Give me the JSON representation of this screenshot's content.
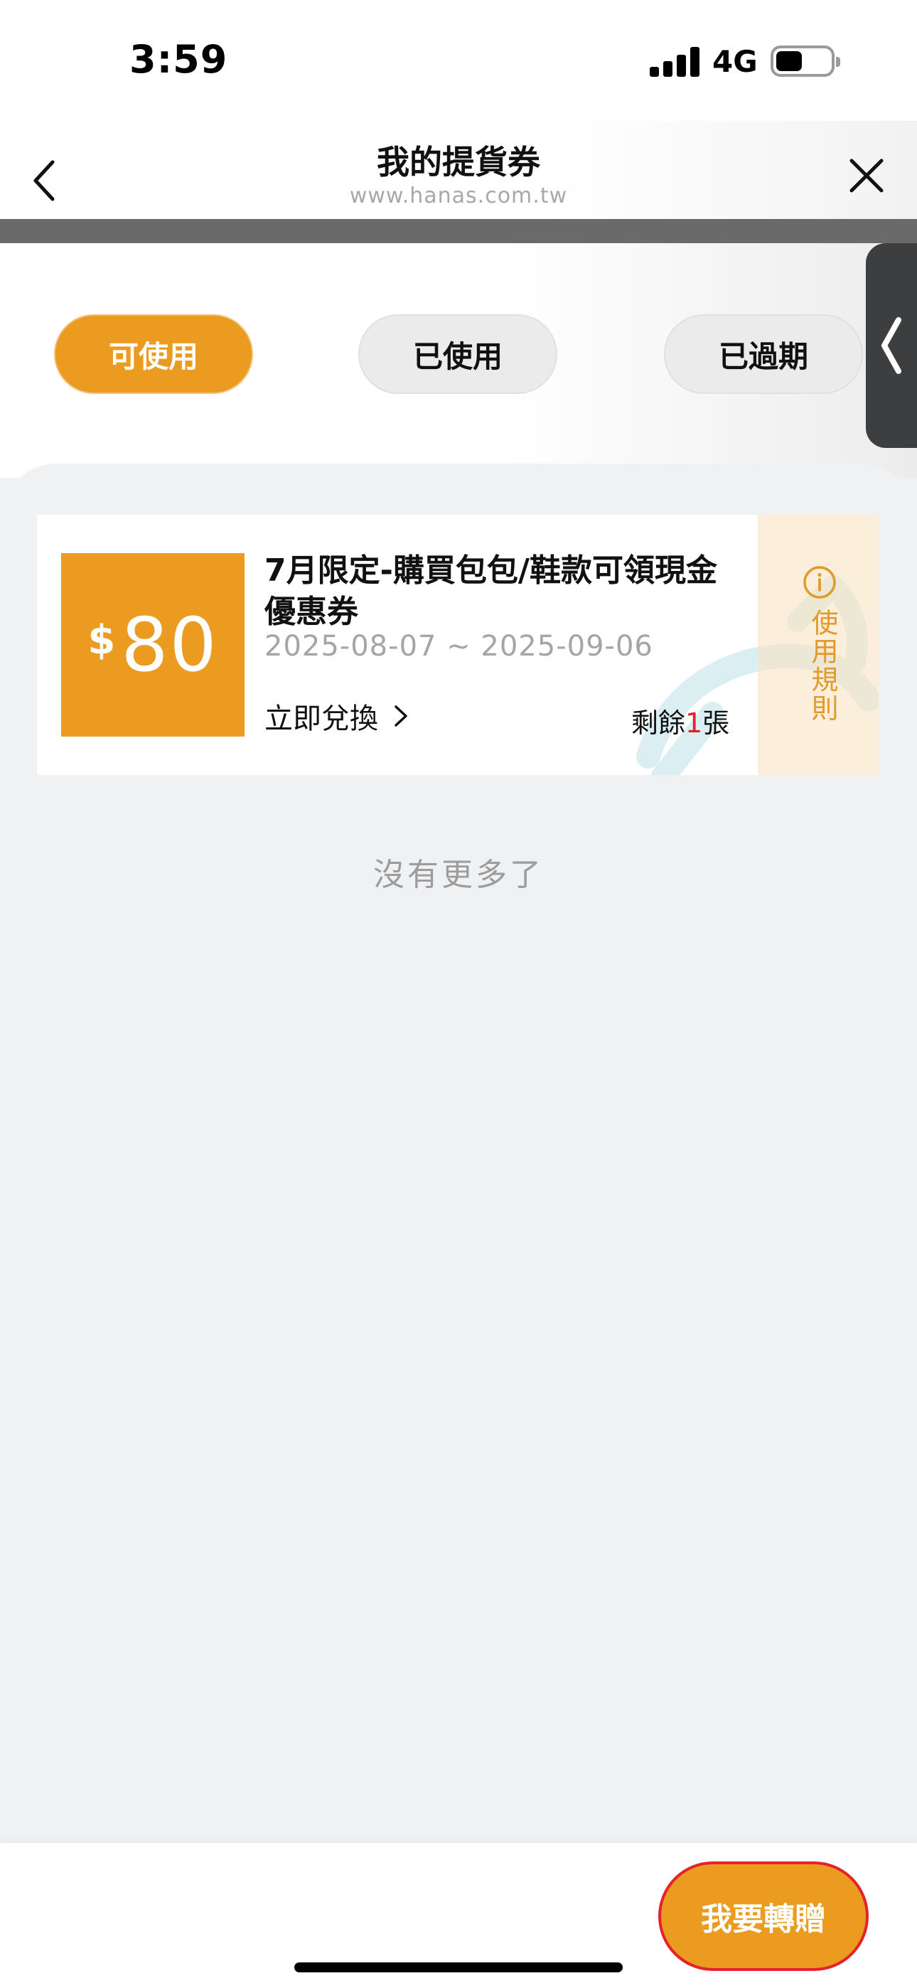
{
  "status_bar": {
    "time": "3:59",
    "network": "4G",
    "signal_level": 4,
    "battery_level": 0.45
  },
  "header": {
    "title": "我的提貨券",
    "subtitle": "www.hanas.com.tw",
    "back_icon": "chevron-left-icon",
    "close_icon": "close-icon"
  },
  "tabs": [
    {
      "label": "可使用",
      "active": true
    },
    {
      "label": "已使用",
      "active": false
    },
    {
      "label": "已過期",
      "active": false
    }
  ],
  "coupon": {
    "currency": "$",
    "amount": "80",
    "title": "7月限定-購買包包/鞋款可領現金優惠券",
    "dates": "2025-08-07 ~ 2025-09-06",
    "redeem_label": "立即兌換",
    "remaining_prefix": "剩餘",
    "remaining_count": "1",
    "remaining_suffix": "張",
    "rules_label": "使用規則",
    "rules_icon": "info-icon"
  },
  "list_end_text": "沒有更多了",
  "footer": {
    "gift_button_label": "我要轉贈"
  },
  "colors": {
    "accent": "#eb9b20",
    "alert_red": "#e0202a",
    "rules_text": "#e29a2a"
  }
}
